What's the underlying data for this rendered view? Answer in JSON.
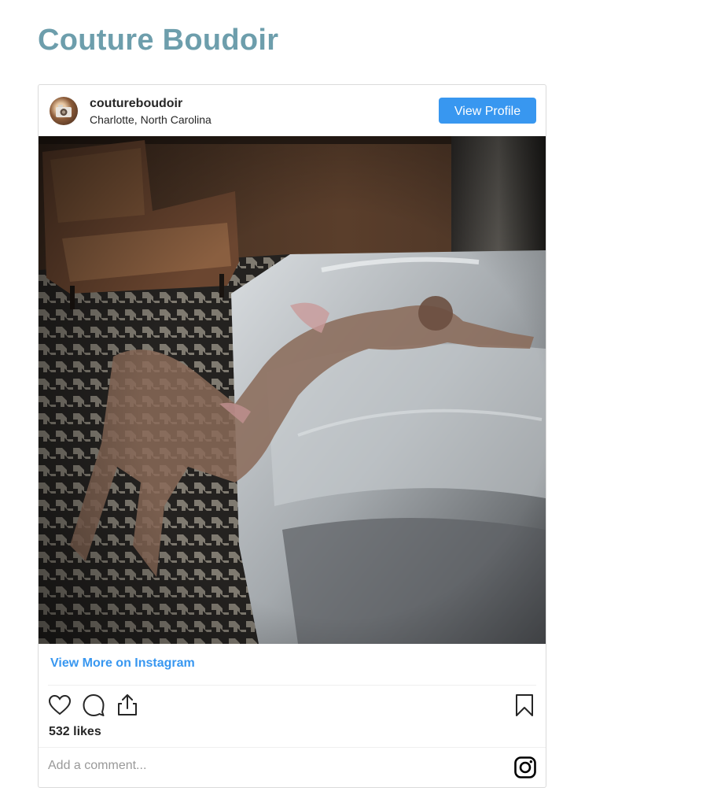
{
  "page": {
    "title": "Couture Boudoir"
  },
  "post": {
    "username": "coutureboudoir",
    "location": "Charlotte, North Carolina",
    "view_profile_label": "View Profile",
    "view_more_label": "View More on Instagram",
    "likes": "532 likes",
    "comment_placeholder": "Add a comment..."
  },
  "icons": [
    "heart-icon",
    "comment-icon",
    "share-icon",
    "bookmark-icon",
    "instagram-icon"
  ],
  "colors": {
    "title": "#6d9eac",
    "button": "#3897f0",
    "link": "#3897f0",
    "text": "#262626",
    "placeholder": "#999999"
  }
}
